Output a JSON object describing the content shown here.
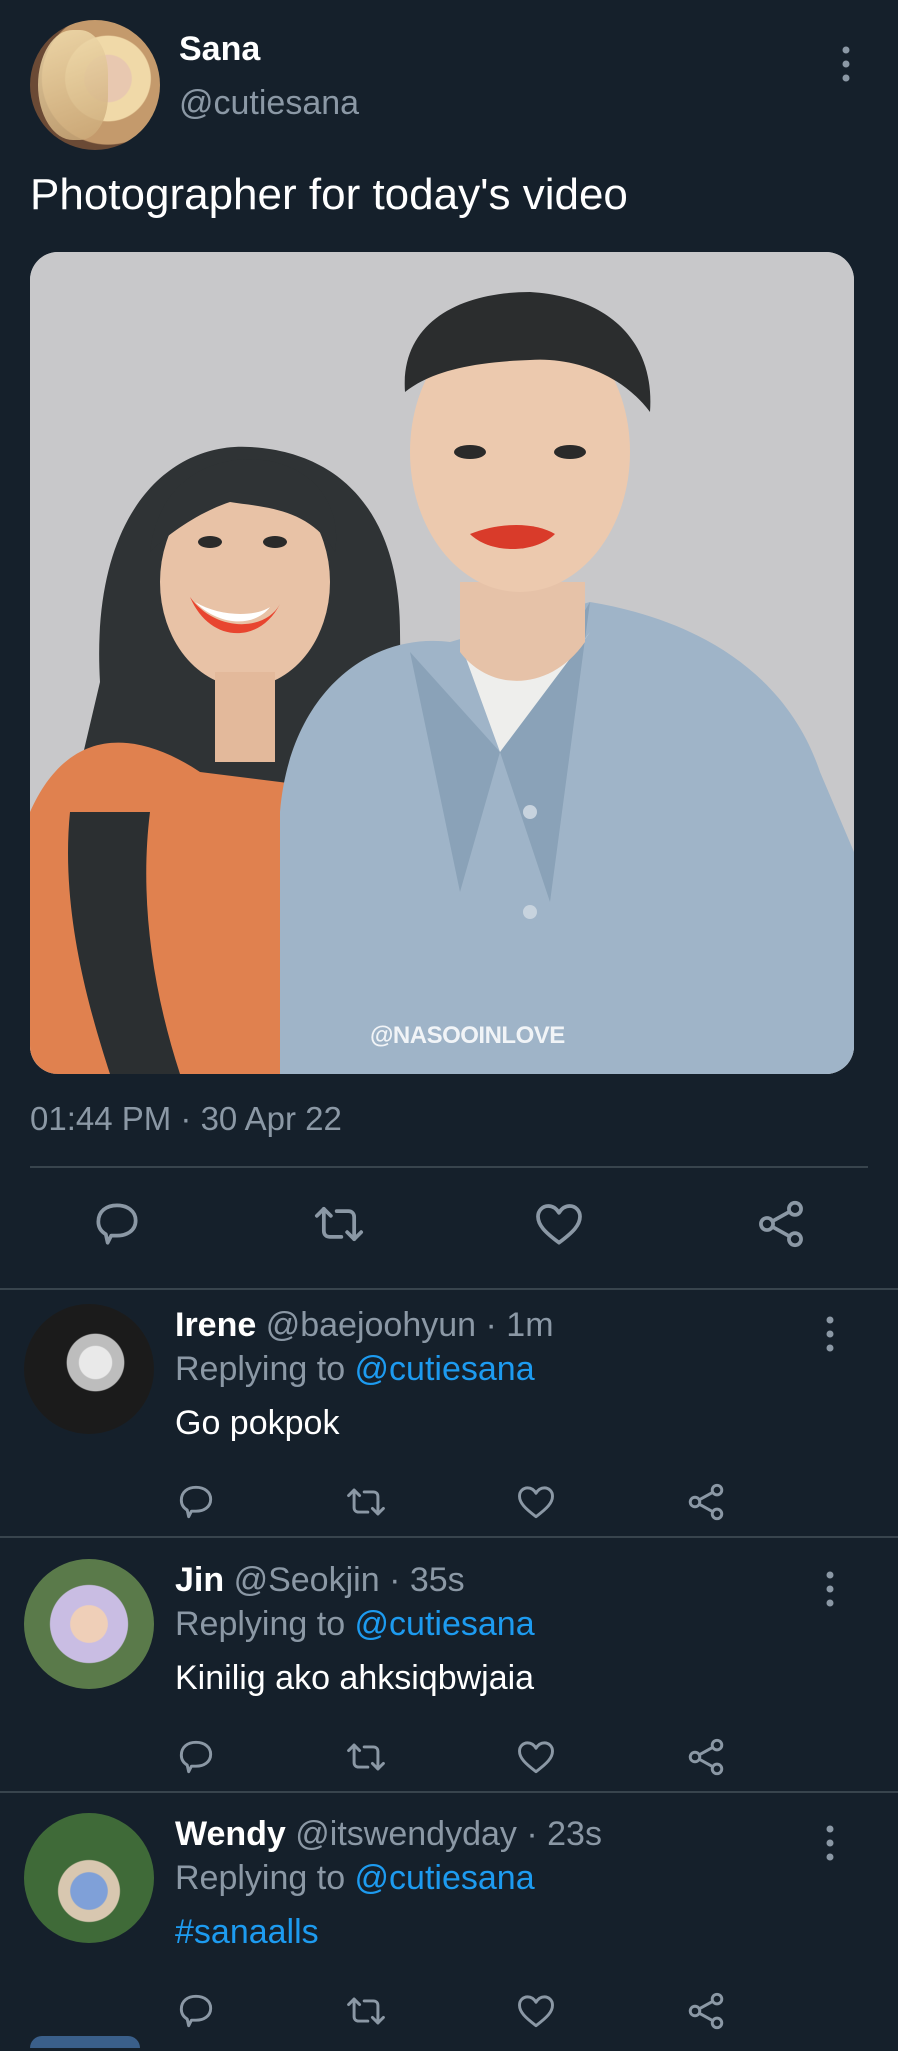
{
  "main_tweet": {
    "author_name": "Sana",
    "author_handle": "@cutiesana",
    "text": "Photographer for today's video",
    "media_watermark": "@NASOOINLOVE",
    "timestamp": "01:44 PM · 30 Apr 22"
  },
  "replies": [
    {
      "name": "Irene",
      "handle": "@baejoohyun",
      "time": "· 1m",
      "replying_prefix": "Replying to ",
      "replying_mention": "@cutiesana",
      "text": "Go pokpok"
    },
    {
      "name": "Jin",
      "handle": "@Seokjin",
      "time": "· 35s",
      "replying_prefix": "Replying to ",
      "replying_mention": "@cutiesana",
      "text": "Kinilig ako ahksiqbwjaia"
    },
    {
      "name": "Wendy",
      "handle": "@itswendyday",
      "time": "· 23s",
      "replying_prefix": "Replying to ",
      "replying_mention": "@cutiesana",
      "text": "#sanaalls"
    }
  ],
  "icons": {
    "reply": "reply-icon",
    "retweet": "retweet-icon",
    "like": "heart-icon",
    "share": "share-icon",
    "more": "more-vertical-icon"
  },
  "colors": {
    "background": "#15202b",
    "divider": "#38444d",
    "secondary_text": "#8b98a5",
    "link": "#1d9bf0",
    "icon": "#8b98a5"
  }
}
